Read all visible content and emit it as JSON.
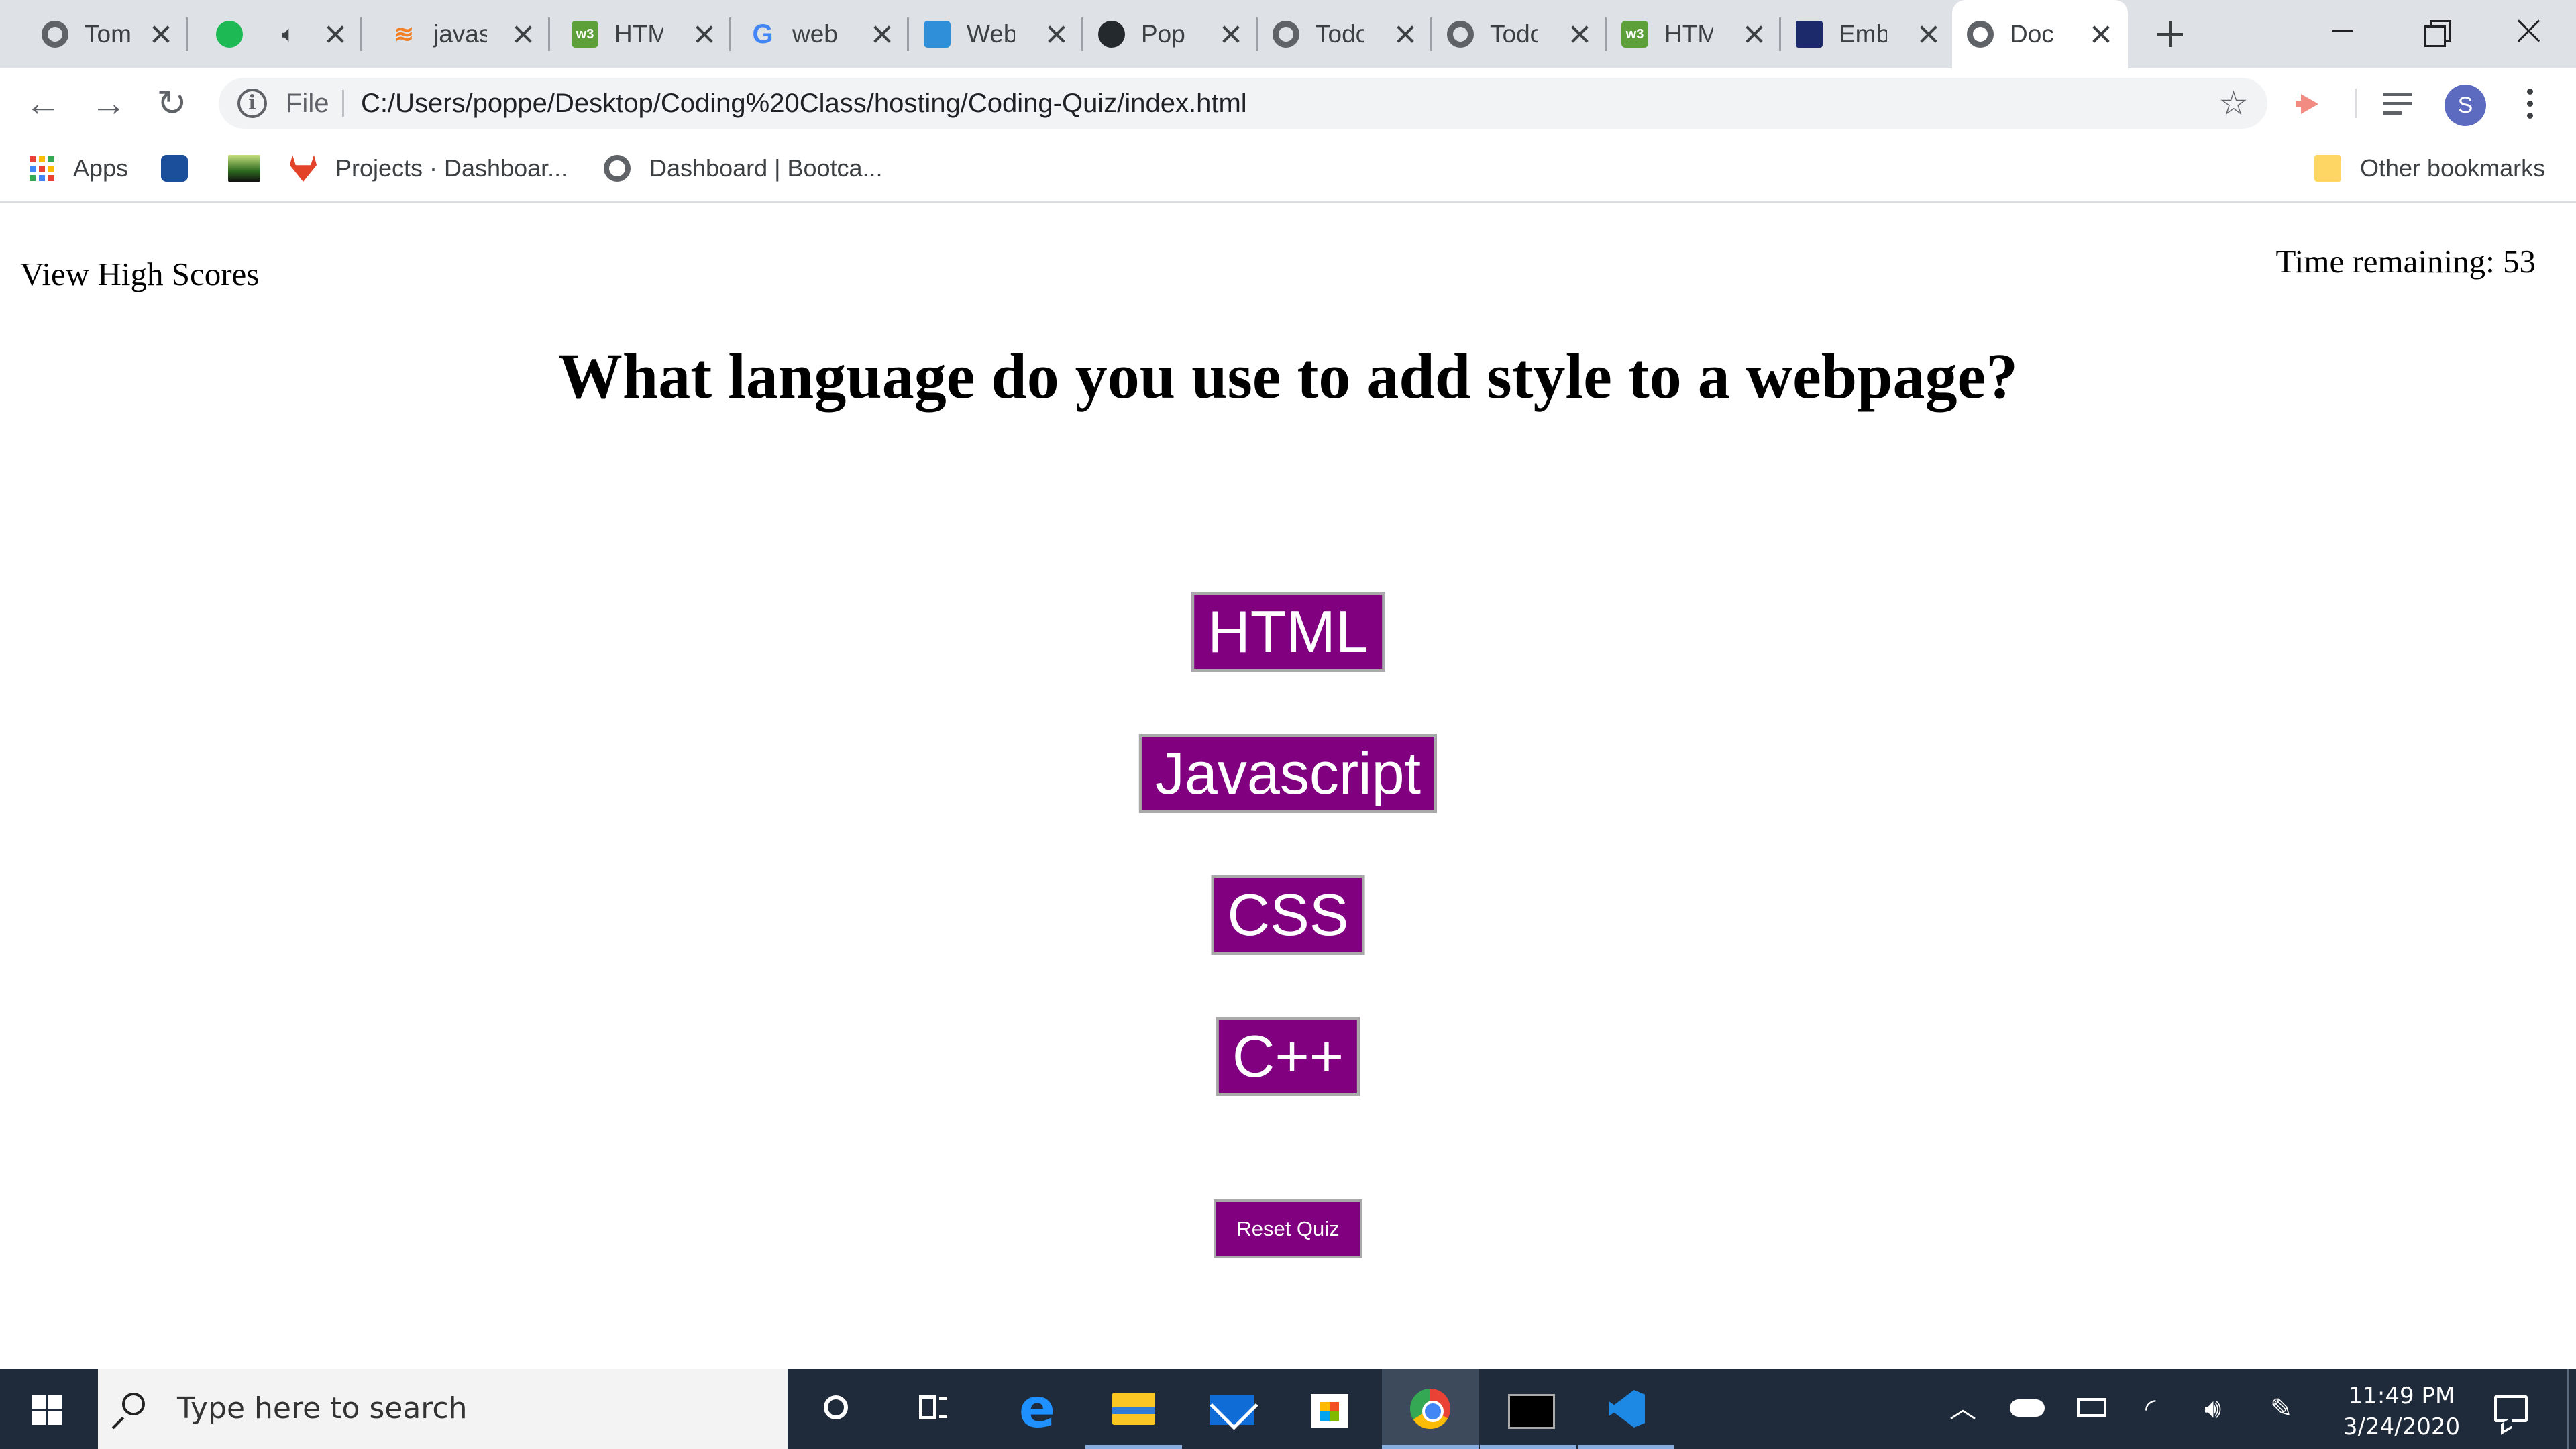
{
  "browser": {
    "tabs": [
      {
        "title": "Tom",
        "icon": "globe-icon"
      },
      {
        "title": "",
        "icon": "spotify-icon",
        "audio": true
      },
      {
        "title": "javas",
        "icon": "stackoverflow-icon"
      },
      {
        "title": "HTM",
        "icon": "w3schools-icon"
      },
      {
        "title": "web",
        "icon": "google-icon"
      },
      {
        "title": "Web",
        "icon": "web-icon"
      },
      {
        "title": "Pop",
        "icon": "github-icon"
      },
      {
        "title": "Todo",
        "icon": "globe-icon"
      },
      {
        "title": "Todo",
        "icon": "globe-icon"
      },
      {
        "title": "HTM",
        "icon": "w3schools-icon"
      },
      {
        "title": "Emb",
        "icon": "emb-icon"
      },
      {
        "title": "Doc",
        "icon": "globe-icon",
        "active": true
      }
    ],
    "address": {
      "scheme_label": "File",
      "url": "C:/Users/poppe/Desktop/Coding%20Class/hosting/Coding-Quiz/index.html"
    },
    "profile_initial": "S",
    "bookmarks": {
      "apps": "Apps",
      "items": [
        {
          "label": "Projects · Dashboar...",
          "icon": "gitlab-icon"
        },
        {
          "label": "Dashboard | Bootca...",
          "icon": "globe-icon"
        }
      ],
      "other": "Other bookmarks"
    }
  },
  "quiz": {
    "view_high_scores": "View High Scores",
    "timer_label": "Time remaining: 53",
    "time_remaining": 53,
    "question": "What language do you use to add style to a webpage?",
    "answers": [
      "HTML",
      "Javascript",
      "CSS",
      "C++"
    ],
    "reset_label": "Reset Quiz",
    "accent_color": "#800080"
  },
  "taskbar": {
    "search_placeholder": "Type here to search",
    "time": "11:49 PM",
    "date": "3/24/2020"
  }
}
